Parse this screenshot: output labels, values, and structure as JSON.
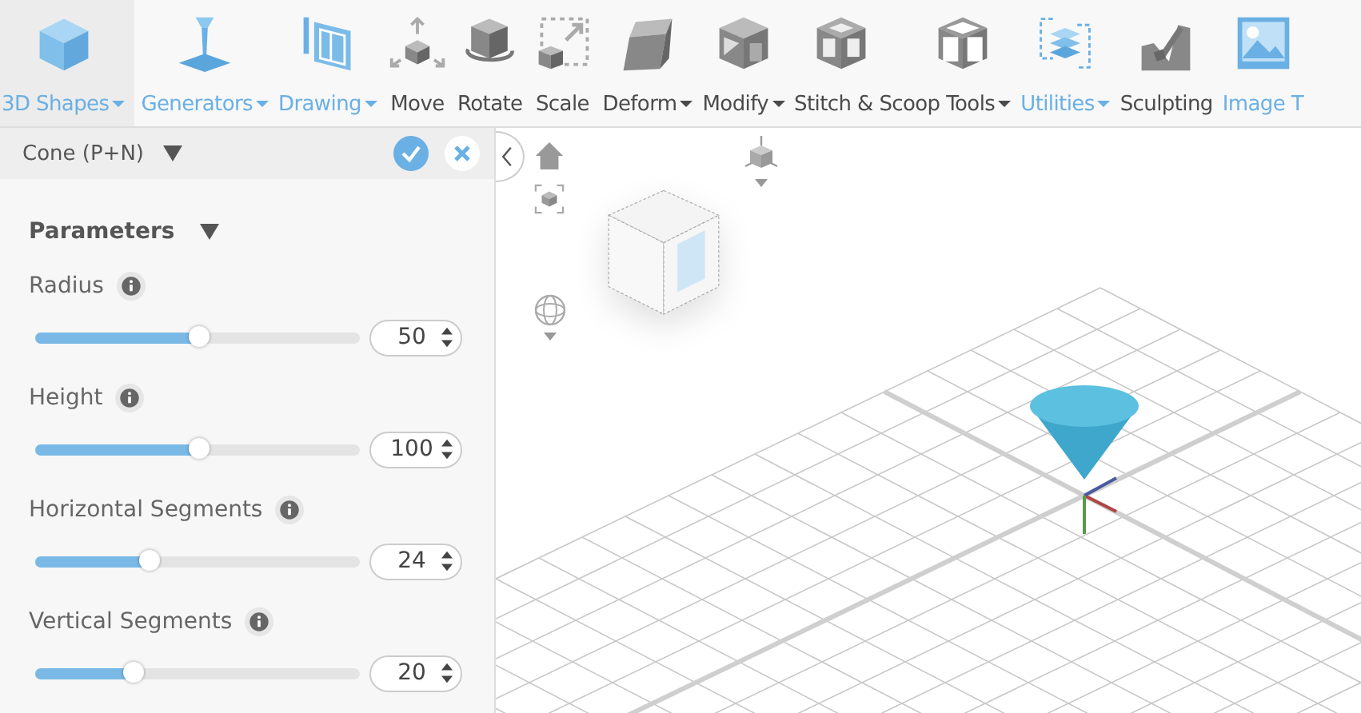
{
  "toolbar": {
    "items": [
      {
        "label": "3D Shapes",
        "has_menu": true,
        "color": "#6ab0e4",
        "selected": true
      },
      {
        "label": "Generators",
        "has_menu": true,
        "color": "#6ab0e4",
        "selected": false
      },
      {
        "label": "Drawing",
        "has_menu": true,
        "color": "#6ab0e4",
        "selected": false
      },
      {
        "label": "Move",
        "has_menu": false,
        "color": "#4a4a4a",
        "selected": false
      },
      {
        "label": "Rotate",
        "has_menu": false,
        "color": "#4a4a4a",
        "selected": false
      },
      {
        "label": "Scale",
        "has_menu": false,
        "color": "#4a4a4a",
        "selected": false
      },
      {
        "label": "Deform",
        "has_menu": true,
        "color": "#4a4a4a",
        "selected": false
      },
      {
        "label": "Modify",
        "has_menu": true,
        "color": "#4a4a4a",
        "selected": false
      },
      {
        "label": "Stitch & Scoop Tools",
        "has_menu": true,
        "color": "#4a4a4a",
        "selected": false
      },
      {
        "label": "Utilities",
        "has_menu": true,
        "color": "#6ab0e4",
        "selected": false
      },
      {
        "label": "Sculpting",
        "has_menu": false,
        "color": "#4a4a4a",
        "selected": false
      },
      {
        "label": "Image T",
        "has_menu": false,
        "color": "#6ab0e4",
        "selected": false
      }
    ]
  },
  "panel": {
    "title": "Cone (P+N)",
    "section": "Parameters",
    "params": [
      {
        "name": "Radius",
        "level": 0.5,
        "value": "50"
      },
      {
        "name": "Height",
        "level": 0.5,
        "value": "100"
      },
      {
        "name": "Horizontal Segments",
        "level": 0.35,
        "value": "24"
      },
      {
        "name": "Vertical Segments",
        "level": 0.3,
        "value": "20"
      }
    ]
  }
}
